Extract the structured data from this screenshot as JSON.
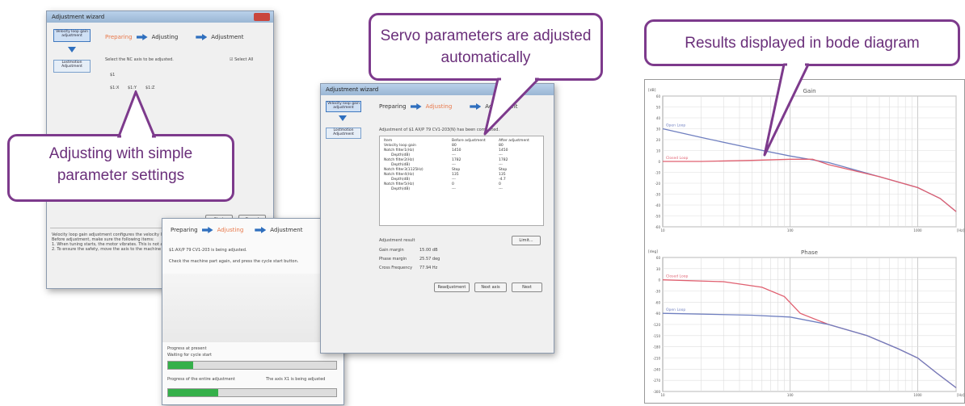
{
  "window_back": {
    "title": "Adjustment wizard",
    "sidebar": [
      "Velocity loop gain adjustment",
      "Lostmotion Adjustment"
    ],
    "steps": [
      "Preparing",
      "Adjusting",
      "Adjustment"
    ],
    "select_label": "Select the NC axis to be adjusted.",
    "select_all": "Select All",
    "axis_group": "$1",
    "axes": [
      "$1:X",
      "$1:Y",
      "$1:Z"
    ],
    "buttons": [
      "Next",
      "Cancel"
    ],
    "notes": [
      "Velocity loop gain adjustment configures the velocity loop gain ...",
      "Before adjustment, make sure the following items:",
      "1. When tuning starts, the motor vibrates. This is not an error.",
      "2. To ensure the safety, move the axis to the machine center."
    ]
  },
  "window_mid": {
    "steps": [
      "Preparing",
      "Adjusting",
      "Adjustment"
    ],
    "status": "$1:AX/P 79 CV1-203 is being adjusted.",
    "instruction": "Check the machine part again, and press the cycle start button.",
    "progress_present_label": "Progress at present",
    "progress_present_status": "Waiting for cycle start",
    "progress_present": 0.15,
    "progress_entire_label": "Progress of the entire adjustment",
    "progress_entire_status": "The axis X1 is being adjusted",
    "progress_entire": 0.3
  },
  "window_front": {
    "title": "Adjustment wizard",
    "sidebar": [
      "Velocity loop gain adjustment",
      "Lostmotion Adjustment"
    ],
    "steps": [
      "Preparing",
      "Adjusting",
      "Adjustment"
    ],
    "completed": "Adjustment of $1 AX/P 79 CV1-203(N) has been completed.",
    "table_headers": [
      "Item",
      "Before adjustment",
      "After adjustment"
    ],
    "table_rows": [
      [
        "Velocity loop gain",
        "80",
        "80"
      ],
      [
        "Notch filter1(Hz)",
        "1450",
        "1450"
      ],
      [
        "Depth(dB)",
        "---",
        "---"
      ],
      [
        "Notch filter2(Hz)",
        "1782",
        "1782"
      ],
      [
        "Depth(dB)",
        "---",
        "---"
      ],
      [
        "Notch filter3(1125Hz)",
        "Stop",
        "Stop"
      ],
      [
        "Notch filter4(Hz)",
        "135",
        "135"
      ],
      [
        "Depth(dB)",
        "---",
        "-4.7"
      ],
      [
        "Notch filter5(Hz)",
        "0",
        "0"
      ],
      [
        "Depth(dB)",
        "---",
        "---"
      ]
    ],
    "result_label": "Adjustment result",
    "results": [
      [
        "Gain margin",
        "15.00 dB"
      ],
      [
        "Phase margin",
        "25.57 deg"
      ],
      [
        "Cross Frequency",
        "77.94 Hz"
      ]
    ],
    "limit_button": "Limit...",
    "buttons": [
      "Readjustment",
      "Next axis",
      "Next"
    ]
  },
  "callouts": {
    "simple": "Adjusting with simple parameter settings",
    "servo": "Servo parameters are adjusted automatically",
    "bode": "Results displayed in bode diagram"
  },
  "chart_data": [
    {
      "type": "line",
      "title": "Gain",
      "ylabel": "[dB]",
      "xlabel": "[Hz]",
      "x_scale": "log",
      "xlim": [
        10,
        2000
      ],
      "ylim": [
        -60,
        60
      ],
      "x_ticks": [
        "10",
        "100",
        "1000"
      ],
      "y_ticks": [
        "60",
        "50",
        "40",
        "30",
        "20",
        "10",
        "0",
        "-10",
        "-20",
        "-30",
        "-40",
        "-50",
        "-60"
      ],
      "grid": true,
      "series": [
        {
          "name": "Open Loop",
          "color": "#6f7fc0",
          "x": [
            10,
            20,
            50,
            100,
            200,
            500,
            1000,
            1500,
            2000
          ],
          "y": [
            30,
            22,
            12,
            5,
            -1,
            -14,
            -24,
            -34,
            -46
          ]
        },
        {
          "name": "Closed Loop",
          "color": "#e06070",
          "x": [
            10,
            20,
            50,
            100,
            150,
            200,
            500,
            1000,
            1500,
            2000
          ],
          "y": [
            0,
            0,
            1,
            2,
            2,
            -3,
            -14,
            -24,
            -34,
            -46
          ]
        }
      ]
    },
    {
      "type": "line",
      "title": "Phase",
      "ylabel": "[deg]",
      "xlabel": "[Hz]",
      "x_scale": "log",
      "xlim": [
        10,
        2000
      ],
      "ylim": [
        -300,
        60
      ],
      "x_ticks": [
        "10",
        "100",
        "1000"
      ],
      "y_ticks": [
        "60",
        "30",
        "0",
        "-30",
        "-60",
        "-90",
        "-120",
        "-150",
        "-180",
        "-210",
        "-240",
        "-270",
        "-300"
      ],
      "grid": true,
      "series": [
        {
          "name": "Closed Loop",
          "color": "#e06070",
          "x": [
            10,
            30,
            60,
            90,
            120,
            200,
            400,
            700,
            1000,
            1400,
            2000
          ],
          "y": [
            0,
            -5,
            -20,
            -45,
            -90,
            -120,
            -150,
            -185,
            -210,
            -250,
            -290
          ]
        },
        {
          "name": "Open Loop",
          "color": "#6f7fc0",
          "x": [
            10,
            50,
            100,
            200,
            400,
            700,
            1000,
            1400,
            2000
          ],
          "y": [
            -90,
            -95,
            -100,
            -120,
            -150,
            -185,
            -210,
            -250,
            -290
          ]
        }
      ]
    }
  ]
}
